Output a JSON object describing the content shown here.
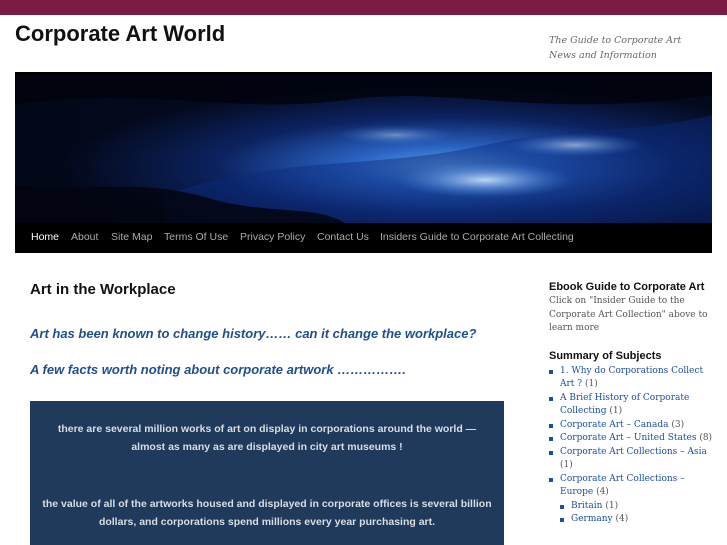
{
  "site": {
    "title": "Corporate Art World",
    "description": "The Guide to Corporate Art News and Information"
  },
  "nav": {
    "items": [
      {
        "label": "Home",
        "active": true
      },
      {
        "label": "About"
      },
      {
        "label": "Site Map"
      },
      {
        "label": "Terms Of Use"
      },
      {
        "label": "Privacy Policy"
      },
      {
        "label": "Contact Us"
      },
      {
        "label": "Insiders Guide to Corporate Art Collecting"
      }
    ]
  },
  "main": {
    "title": "Art in the Workplace",
    "lead1": "Art has been known to change history…… can it change the workplace?",
    "lead2": "A few facts worth noting about corporate artwork  …………….",
    "fact1": "there are several million works of art on display in corporations around the world — almost as many as are displayed in city art museums !",
    "fact2": "the value of all of the artworks housed and displayed in corporate offices is several billion dollars, and corporations spend millions every year purchasing art."
  },
  "sidebar": {
    "ebook": {
      "title": "Ebook Guide to Corporate Art",
      "text": "Click on \"Insider Guide to the Corporate Art Collection\" above to learn more"
    },
    "subjects": {
      "title": "Summary of Subjects",
      "items": [
        {
          "label": "1. Why do Corporations Collect Art ?",
          "count": "(1)"
        },
        {
          "label": "A Brief History of Corporate Collecting",
          "count": "(1)"
        },
        {
          "label": "Corporate Art – Canada",
          "count": "(3)"
        },
        {
          "label": "Corporate Art – United States",
          "count": "(8)"
        },
        {
          "label": "Corporate Art Collections – Asia",
          "count": "(1)"
        },
        {
          "label": "Corporate Art Collections – Europe",
          "count": "(4)"
        }
      ],
      "children": [
        {
          "label": "Britain",
          "count": "(1)"
        },
        {
          "label": "Germany",
          "count": "(4)"
        }
      ]
    }
  },
  "colors": {
    "topbar": "#7d1a43",
    "nav_bg": "#000000",
    "lead_text": "#1e4f8e",
    "factbox_bg": "#1f3a5a",
    "link": "#1b4fa0"
  }
}
